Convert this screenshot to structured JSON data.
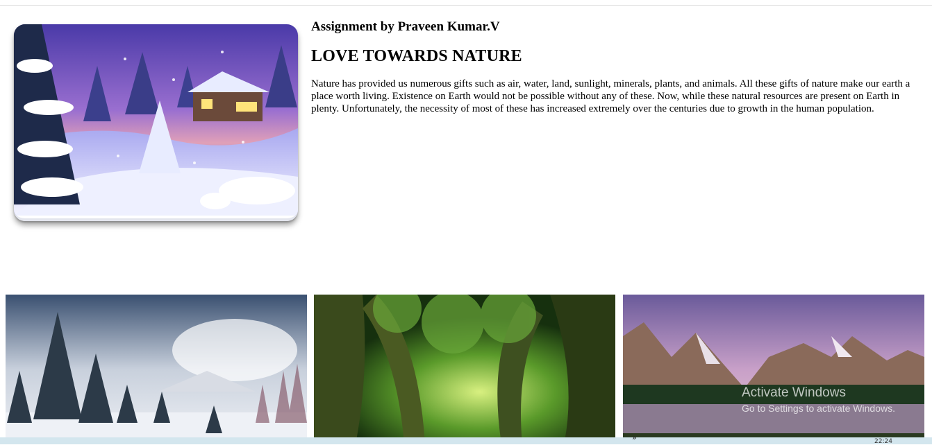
{
  "header": {
    "author": "Assignment by Praveen Kumar.V",
    "title": "LOVE TOWARDS NATURE"
  },
  "content": {
    "paragraph": "Nature has provided us numerous gifts such as air, water, land, sunlight, minerals, plants, and animals. All these gifts of nature make our earth a place worth living. Existence on Earth would not be possible without any of these. Now, while these natural resources are present on Earth in plenty. Unfortunately, the necessity of most of these has increased extremely over the centuries due to growth in the human population."
  },
  "images": {
    "hero": "winter-cabin-night-image",
    "gallery": [
      "snowy-pine-forest-image",
      "green-forest-tunnel-image",
      "mountain-lake-image"
    ]
  },
  "watermark": {
    "line1": "Activate Windows",
    "line2": "Go to Settings to activate Windows."
  },
  "taskbar": {
    "chevron": "»",
    "clock": "22:24"
  },
  "colors": {
    "taskbar": "#d3e6ee",
    "divider": "#dadada"
  }
}
